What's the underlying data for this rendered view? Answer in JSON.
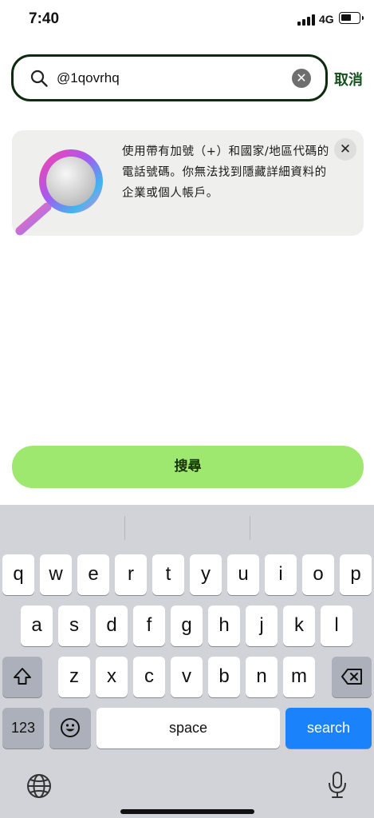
{
  "status_bar": {
    "time": "7:40",
    "network": "4G"
  },
  "search": {
    "query": "@1qovrhq",
    "cancel_label": "取消"
  },
  "info_card": {
    "text": "使用帶有加號（+）和國家/地區代碼的電話號碼。你無法找到隱藏詳細資料的企業或個人帳戶。",
    "close_glyph": "✕"
  },
  "search_button": {
    "label": "搜尋"
  },
  "keyboard": {
    "row1": [
      "q",
      "w",
      "e",
      "r",
      "t",
      "y",
      "u",
      "i",
      "o",
      "p"
    ],
    "row2": [
      "a",
      "s",
      "d",
      "f",
      "g",
      "h",
      "j",
      "k",
      "l"
    ],
    "row3": [
      "z",
      "x",
      "c",
      "v",
      "b",
      "n",
      "m"
    ],
    "numbers_label": "123",
    "space_label": "space",
    "action_label": "search"
  },
  "icons": {
    "shift": "shift-icon",
    "delete": "delete-icon",
    "emoji": "emoji-icon",
    "globe": "globe-icon",
    "mic": "microphone-icon"
  },
  "colors": {
    "accent_green": "#9fe870",
    "dark_green": "#17501f",
    "keyboard_action_blue": "#1a82fb"
  }
}
